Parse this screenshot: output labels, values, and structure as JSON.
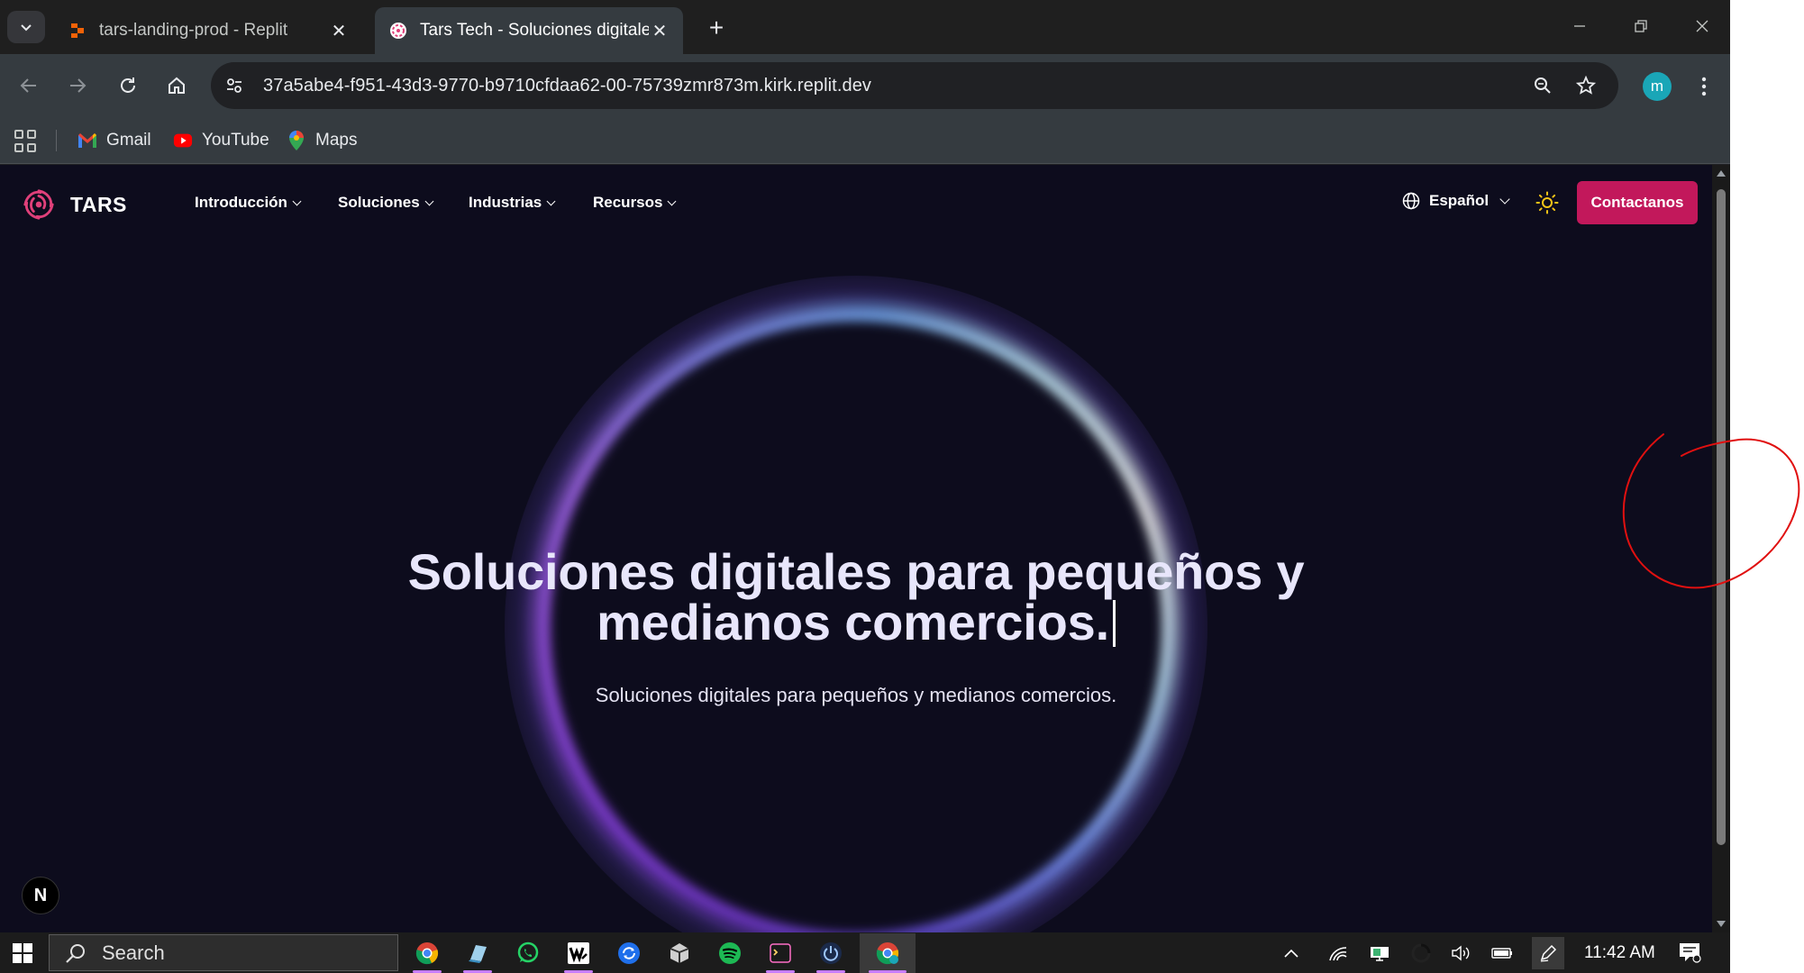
{
  "browser": {
    "tabs": [
      {
        "title": "tars-landing-prod - Replit",
        "active": false
      },
      {
        "title": "Tars Tech - Soluciones digitales",
        "active": true
      }
    ],
    "url": "37a5abe4-f951-43d3-9770-b9710cfdaa62-00-75739zmr873m.kirk.replit.dev",
    "profile_initial": "m",
    "bookmarks": [
      {
        "label": "Gmail",
        "icon": "gmail-icon"
      },
      {
        "label": "YouTube",
        "icon": "youtube-icon"
      },
      {
        "label": "Maps",
        "icon": "maps-icon"
      }
    ]
  },
  "site": {
    "brand": "TARS",
    "menu": [
      {
        "label": "Introducción"
      },
      {
        "label": "Soluciones"
      },
      {
        "label": "Industrias"
      },
      {
        "label": "Recursos"
      }
    ],
    "language": "Español",
    "cta": "Contactanos",
    "hero": {
      "headline_line1": "Soluciones digitales para pequeños y",
      "headline_line2": "medianos comercios.",
      "subheadline": "Soluciones digitales para pequeños y medianos comercios."
    },
    "dev_badge": "N"
  },
  "taskbar": {
    "search_placeholder": "Search",
    "clock": "11:42 AM",
    "apps": [
      "chrome-icon",
      "notepad-icon",
      "whatsapp-icon",
      "wattpad-icon",
      "sync-icon",
      "unity-icon",
      "spotify-icon",
      "terminal-icon",
      "power-icon",
      "chrome-profile-icon"
    ]
  },
  "colors": {
    "page_bg": "#0d0c1d",
    "accent": "#c2185b",
    "ring_purple": "#8e43e8",
    "ring_cyan": "#c8f0ff",
    "annotation": "#e01010"
  }
}
